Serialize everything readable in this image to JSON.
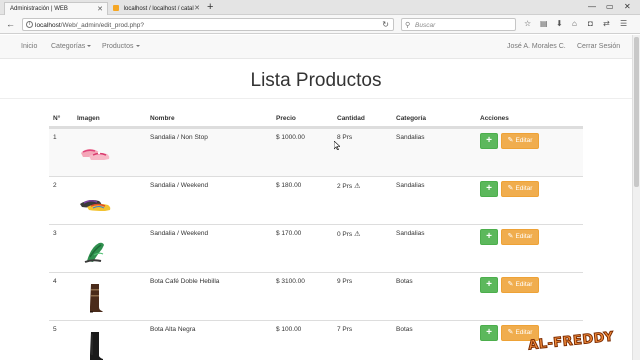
{
  "browser": {
    "tabs": [
      {
        "title": "Administración | WEB",
        "active": true
      },
      {
        "title": "localhost / localhost / catal",
        "active": false
      }
    ],
    "url_host": "localhost",
    "url_path": "/Web/_admin/edit_prod.php?",
    "search_placeholder": "Buscar"
  },
  "site_nav": {
    "home": "Inicio",
    "categories": "Categorías",
    "products": "Productos",
    "user": "José A. Morales C.",
    "logout": "Cerrar Sesión"
  },
  "page": {
    "title": "Lista Productos"
  },
  "table": {
    "headers": [
      "N°",
      "Imagen",
      "Nombre",
      "Precio",
      "Cantidad",
      "Categoría",
      "Acciones"
    ],
    "rows": [
      {
        "num": "1",
        "name": "Sandalia / Non Stop",
        "price": "$ 1000.00",
        "qty": "8 Prs",
        "warn": false,
        "category": "Sandalias",
        "image": "pink-sandal"
      },
      {
        "num": "2",
        "name": "Sandalia / Weekend",
        "price": "$ 180.00",
        "qty": "2 Prs",
        "warn": true,
        "category": "Sandalias",
        "image": "multicolor-sandal"
      },
      {
        "num": "3",
        "name": "Sandalia / Weekend",
        "price": "$ 170.00",
        "qty": "0 Prs",
        "warn": true,
        "category": "Sandalias",
        "image": "green-sandal"
      },
      {
        "num": "4",
        "name": "Bota Café Doble Hebilla",
        "price": "$ 3100.00",
        "qty": "9 Prs",
        "warn": false,
        "category": "Botas",
        "image": "brown-boot"
      },
      {
        "num": "5",
        "name": "Bota Alta Negra",
        "price": "$ 100.00",
        "qty": "7 Prs",
        "warn": false,
        "category": "Botas",
        "image": "black-boot"
      }
    ],
    "add_label": "+",
    "edit_label": "Editar"
  },
  "watermark": "AL-FREDDY",
  "colors": {
    "add_button": "#5cb85c",
    "edit_button": "#f0ad4e",
    "watermark": "#f08a3a"
  }
}
